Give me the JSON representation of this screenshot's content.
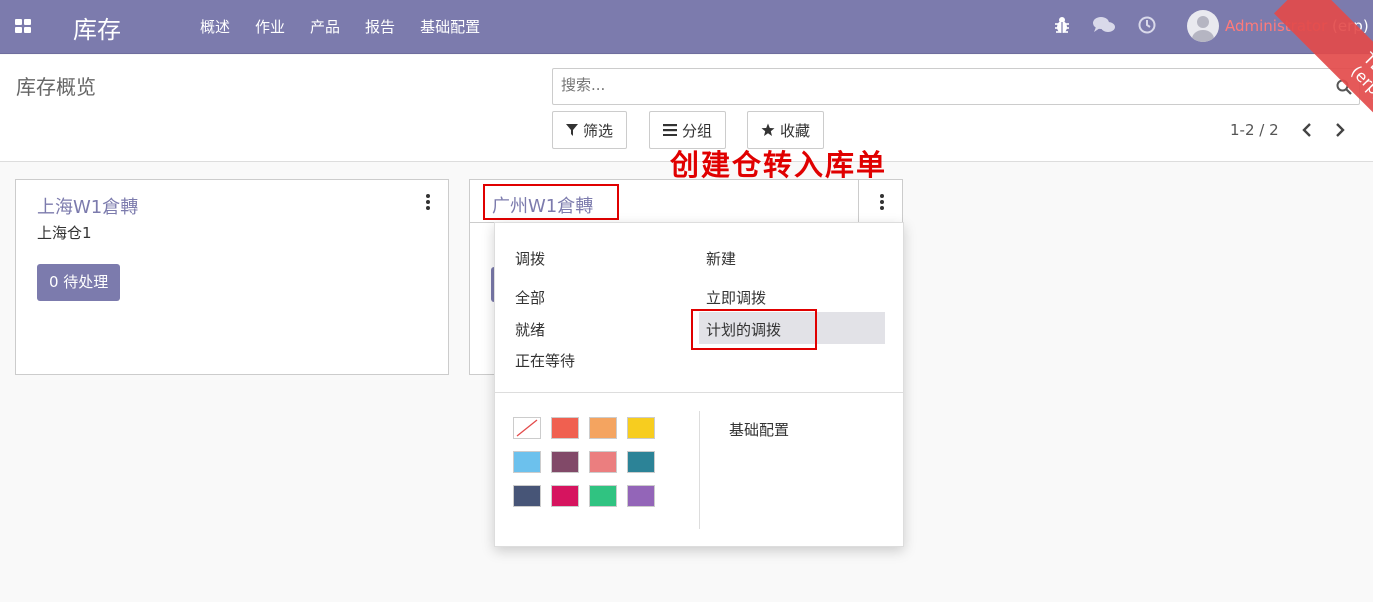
{
  "navbar": {
    "app_name": "库存",
    "menu": [
      "概述",
      "作业",
      "产品",
      "报告",
      "基础配置"
    ],
    "user_name": "Administrator",
    "db": "(erp)",
    "ribbon_line1": "TEST",
    "ribbon_line2": "(erp)",
    "colors": {
      "bar": "#7c7bad",
      "ribbon": "#e34b4b",
      "username": "#ff7a7a"
    }
  },
  "control_panel": {
    "breadcrumb": "库存概览",
    "search_placeholder": "搜索...",
    "filter_label": "筛选",
    "group_label": "分组",
    "favorites_label": "收藏",
    "pager": "1-2 / 2"
  },
  "annotation": {
    "text": "创建仓转入库单",
    "color": "#e00000"
  },
  "cards": [
    {
      "title": "上海W1倉轉",
      "subtitle": "上海仓1",
      "pending_label": "0 待处理"
    },
    {
      "title": "广州W1倉轉"
    }
  ],
  "dropdown": {
    "transfers_header": "调拨",
    "transfers": [
      "全部",
      "就绪",
      "正在等待"
    ],
    "new_header": "新建",
    "new_items": [
      "立即调拨",
      "计划的调拨"
    ],
    "active_item": "计划的调拨",
    "settings": "基础配置",
    "colors": [
      "#ffffff",
      "#f06050",
      "#f4a460",
      "#f7cd1f",
      "#6cc1ed",
      "#814968",
      "#eb7e7f",
      "#2c8397",
      "#475577",
      "#d6145f",
      "#30c381",
      "#9365b8"
    ]
  },
  "icons": [
    "apps-icon",
    "bug-icon",
    "chat-icon",
    "clock-icon",
    "search-icon",
    "filter-icon",
    "group-icon",
    "star-icon",
    "chevron-left-icon",
    "chevron-right-icon",
    "kebab-icon"
  ]
}
